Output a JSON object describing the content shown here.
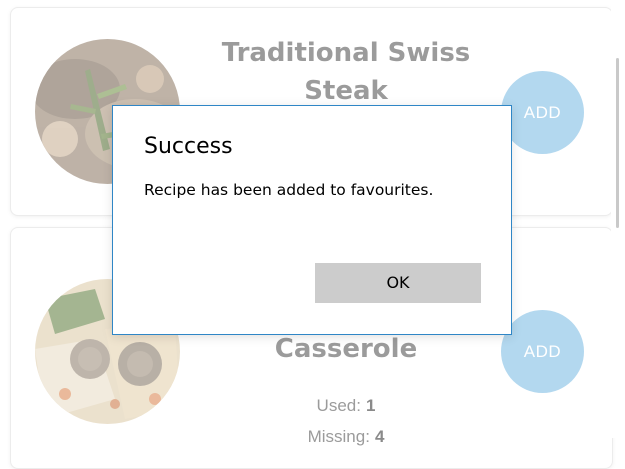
{
  "recipes": [
    {
      "title": "Traditional Swiss Steak",
      "add_label": "ADD"
    },
    {
      "title": "Casserole",
      "add_label": "ADD",
      "used_label": "Used:",
      "used_count": "1",
      "missing_label": "Missing:",
      "missing_count": "4"
    }
  ],
  "dialog": {
    "title": "Success",
    "message": "Recipe has been added to favourites.",
    "ok_label": "OK"
  },
  "colors": {
    "add_button": "#b3d8ef",
    "dialog_border": "#2f86c6",
    "ok_button": "#cccccc",
    "muted_text": "#9b9b9b"
  }
}
